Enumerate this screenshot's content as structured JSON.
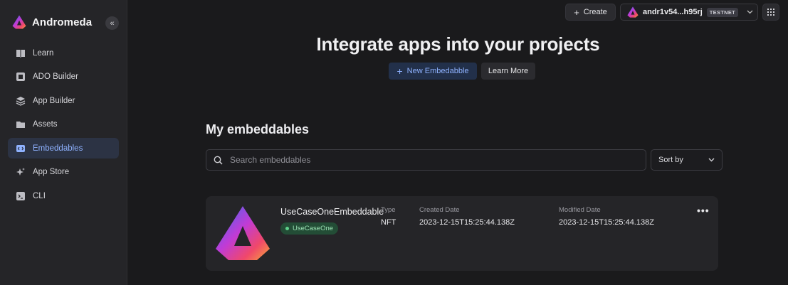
{
  "app": {
    "name": "Andromeda",
    "collapse_icon": "double-chevron-left-icon"
  },
  "sidebar": {
    "items": [
      {
        "label": "Learn",
        "icon": "book-icon",
        "active": false
      },
      {
        "label": "ADO Builder",
        "icon": "ado-builder-icon",
        "active": false
      },
      {
        "label": "App Builder",
        "icon": "layers-icon",
        "active": false
      },
      {
        "label": "Assets",
        "icon": "folder-icon",
        "active": false
      },
      {
        "label": "Embeddables",
        "icon": "embed-icon",
        "active": true
      },
      {
        "label": "App Store",
        "icon": "sparkle-icon",
        "active": false
      },
      {
        "label": "CLI",
        "icon": "terminal-icon",
        "active": false
      }
    ]
  },
  "topbar": {
    "create_label": "Create",
    "wallet_address": "andr1v54...h95rj",
    "network_badge": "TESTNET"
  },
  "hero": {
    "title": "Integrate apps into your projects",
    "new_button": "New Embedabble",
    "learn_button": "Learn More"
  },
  "section": {
    "title": "My embeddables",
    "search_placeholder": "Search embeddables",
    "sort_label": "Sort by"
  },
  "card": {
    "name": "UseCaseOneEmbeddable",
    "tag": "UseCaseOne",
    "type_label": "Type",
    "type_value": "NFT",
    "created_label": "Created Date",
    "created_value": "2023-12-15T15:25:44.138Z",
    "modified_label": "Modified Date",
    "modified_value": "2023-12-15T15:25:44.138Z"
  },
  "colors": {
    "accent": "#8fb2ff",
    "active_bg": "#2c3344",
    "tag_bg": "#234d36",
    "tag_text": "#9be2b4"
  }
}
